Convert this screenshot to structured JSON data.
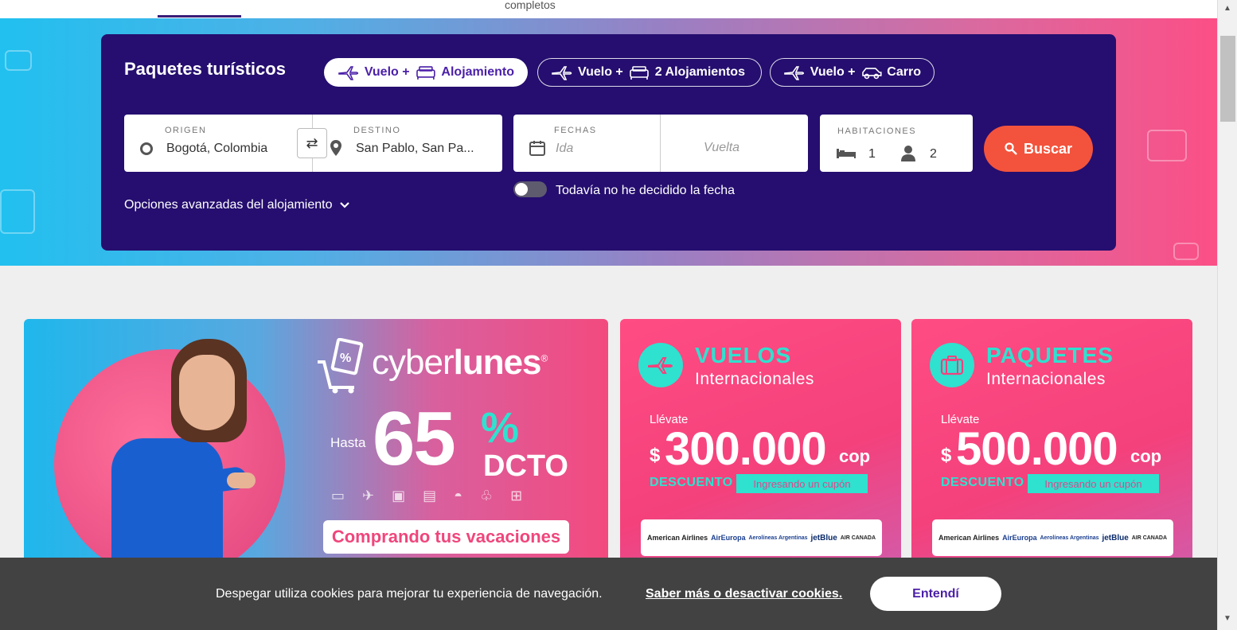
{
  "topbar": {
    "completos": "completos"
  },
  "search": {
    "title": "Paquetes turísticos",
    "pills": [
      {
        "prefix": "Vuelo +",
        "label": "Alojamiento",
        "active": true
      },
      {
        "prefix": "Vuelo +",
        "label": "2 Alojamientos",
        "active": false
      },
      {
        "prefix": "Vuelo +",
        "label": "Carro",
        "active": false
      }
    ],
    "origin": {
      "label": "ORIGEN",
      "value": "Bogotá, Colombia"
    },
    "destination": {
      "label": "DESTINO",
      "value": "San Pablo, San Pa..."
    },
    "dates": {
      "label": "FECHAS",
      "ida_placeholder": "Ida",
      "vuelta_placeholder": "Vuelta"
    },
    "rooms": {
      "label": "HABITACIONES",
      "rooms": "1",
      "people": "2"
    },
    "buscar": "Buscar",
    "undecided": "Todavía no he decidido la fecha",
    "advanced": "Opciones avanzadas del alojamiento"
  },
  "banners": {
    "cyber": {
      "logo_light": "cyber",
      "logo_bold": "lunes",
      "reg": "®",
      "hasta": "Hasta",
      "percent_value": "65",
      "percent_sign": "%",
      "dcto": "DCTO",
      "cta": "Comprando tus vacaciones"
    },
    "vuelos": {
      "title": "VUELOS",
      "subtitle": "Internacionales",
      "llevate": "Llévate",
      "dollar": "$",
      "amount": "300.000",
      "currency": "cop",
      "descuento": "DESCUENTO",
      "cupon": "Ingresando un cupón",
      "airlines": [
        "American Airlines",
        "AirEuropa",
        "Aerolíneas Argentinas",
        "jetBlue",
        "AIR CANADA"
      ]
    },
    "paquetes": {
      "title": "PAQUETES",
      "subtitle": "Internacionales",
      "llevate": "Llévate",
      "dollar": "$",
      "amount": "500.000",
      "currency": "cop",
      "descuento": "DESCUENTO",
      "cupon": "Ingresando un cupón",
      "airlines": [
        "American Airlines",
        "AirEuropa",
        "Aerolíneas Argentinas",
        "jetBlue",
        "AIR CANADA"
      ]
    }
  },
  "cookie": {
    "text": "Despegar utiliza cookies para mejorar tu experiencia de navegación.",
    "link": "Saber más o desactivar cookies.",
    "button": "Entendí"
  },
  "colors": {
    "panel": "#250e6f",
    "accent": "#f3533c",
    "teal": "#2fe1cf",
    "pink": "#f4417c",
    "purple": "#4a1fa8"
  }
}
